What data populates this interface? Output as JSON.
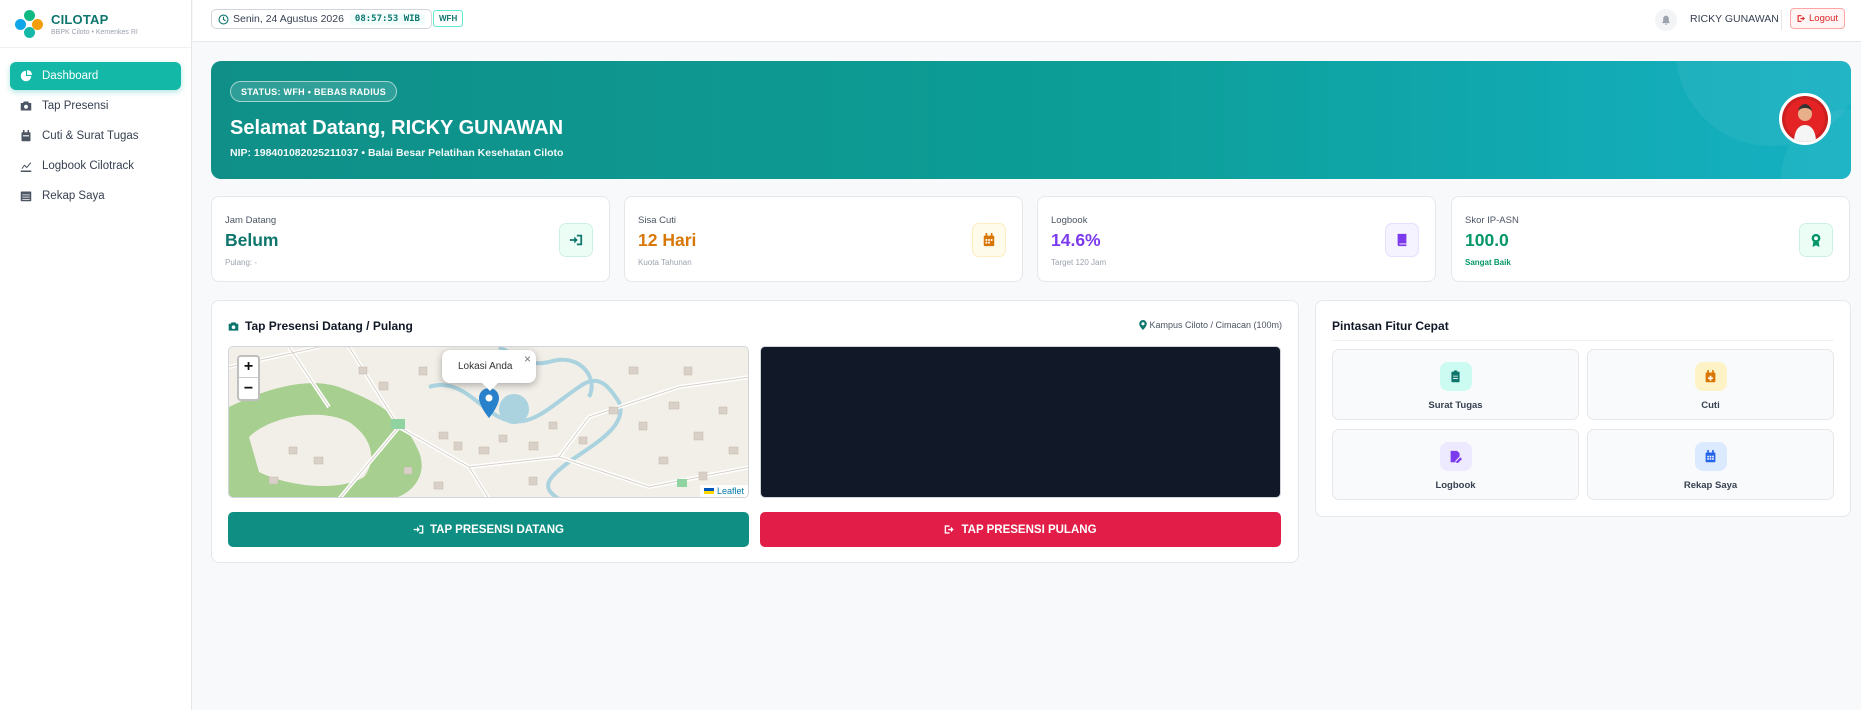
{
  "brand": {
    "name": "CILOTAP",
    "subtitle": "BBPK Ciloto • Kemenkes RI"
  },
  "sidebar": {
    "items": [
      {
        "label": "Dashboard",
        "icon": "chart-pie-icon",
        "active": true
      },
      {
        "label": "Tap Presensi",
        "icon": "camera-icon"
      },
      {
        "label": "Cuti & Surat Tugas",
        "icon": "calendar-icon"
      },
      {
        "label": "Logbook Cilotrack",
        "icon": "chart-line-icon"
      },
      {
        "label": "Rekap Saya",
        "icon": "table-icon"
      }
    ]
  },
  "topbar": {
    "date": "Senin, 24 Agustus 2026",
    "time": "08:57:53 WIB",
    "mode_badge": "WFH",
    "user": "RICKY GUNAWAN",
    "logout": "Logout"
  },
  "hero": {
    "badge": "STATUS: WFH • BEBAS RADIUS",
    "title": "Selamat Datang, RICKY GUNAWAN",
    "subtitle": "NIP: 198401082025211037 • Balai Besar Pelatihan Kesehatan Ciloto"
  },
  "stats": [
    {
      "label": "Jam Datang",
      "value": "Belum",
      "sub": "Pulang: -",
      "color": "#0f766e",
      "icon": "sign-in-icon"
    },
    {
      "label": "Sisa Cuti",
      "value": "12 Hari",
      "sub": "Kuota Tahunan",
      "color": "#d97706",
      "icon": "calendar-icon"
    },
    {
      "label": "Logbook",
      "value": "14.6%",
      "sub": "Target 120 Jam",
      "color": "#7c3aed",
      "icon": "book-icon"
    },
    {
      "label": "Skor IP-ASN",
      "value": "100.0",
      "sub": "Sangat Baik",
      "color": "#059669",
      "icon": "award-icon"
    }
  ],
  "presensi": {
    "title": "Tap Presensi Datang / Pulang",
    "location": "Kampus Ciloto / Cimacan (100m)",
    "popup": "Lokasi Anda",
    "attribution": "Leaflet",
    "zoom_in": "+",
    "zoom_out": "−",
    "btn_in": "TAP PRESENSI DATANG",
    "btn_out": "TAP PRESENSI PULANG",
    "btn_in_color": "#0f8f83",
    "btn_out_color": "#e11d48"
  },
  "quick": {
    "title": "Pintasan Fitur Cepat",
    "items": [
      {
        "label": "Surat Tugas",
        "icon": "clipboard-icon",
        "color": "#0f766e",
        "bg": "#ccfbf1"
      },
      {
        "label": "Cuti",
        "icon": "calendar-plus-icon",
        "color": "#d97706",
        "bg": "#fef3c7"
      },
      {
        "label": "Logbook",
        "icon": "edit-file-icon",
        "color": "#7c3aed",
        "bg": "#ede9fe"
      },
      {
        "label": "Rekap Saya",
        "icon": "calendar-grid-icon",
        "color": "#2563eb",
        "bg": "#dbeafe"
      }
    ]
  }
}
